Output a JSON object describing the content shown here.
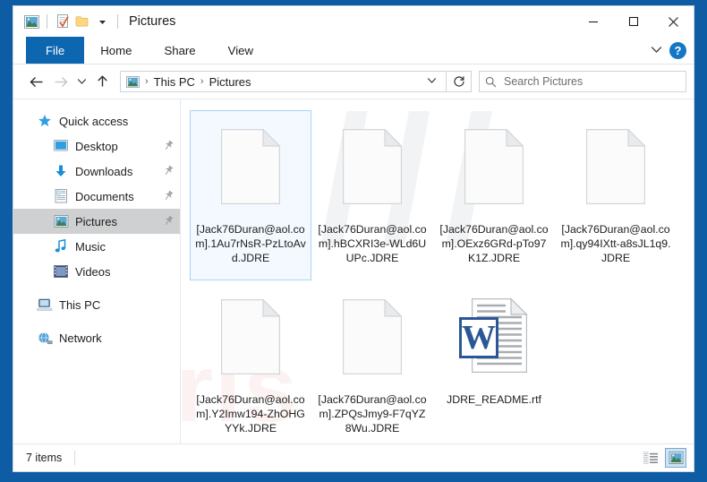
{
  "window": {
    "title": "Pictures",
    "quick_access_icons": [
      "pictures-folder-icon",
      "properties-icon",
      "new-folder-icon",
      "customize-qat-chevron"
    ],
    "controls": {
      "minimize": "–",
      "maximize": "☐",
      "close": "✕"
    }
  },
  "ribbon": {
    "tabs": [
      {
        "label": "File",
        "active": true
      },
      {
        "label": "Home",
        "active": false
      },
      {
        "label": "Share",
        "active": false
      },
      {
        "label": "View",
        "active": false
      }
    ],
    "expand_label": "∨",
    "help_label": "?"
  },
  "address": {
    "back": "←",
    "forward": "→",
    "recent": "∨",
    "up": "↑",
    "breadcrumbs": [
      "This PC",
      "Pictures"
    ],
    "separator": "›",
    "dropdown": "∨",
    "refresh": "↻"
  },
  "search": {
    "placeholder": "Search Pictures",
    "icon": "search-icon"
  },
  "sidebar": {
    "items": [
      {
        "label": "Quick access",
        "icon": "star-icon",
        "level": 0,
        "pinned": false,
        "selected": false
      },
      {
        "label": "Desktop",
        "icon": "desktop-icon",
        "level": 1,
        "pinned": true,
        "selected": false
      },
      {
        "label": "Downloads",
        "icon": "downloads-icon",
        "level": 1,
        "pinned": true,
        "selected": false
      },
      {
        "label": "Documents",
        "icon": "documents-icon",
        "level": 1,
        "pinned": true,
        "selected": false
      },
      {
        "label": "Pictures",
        "icon": "pictures-icon",
        "level": 1,
        "pinned": true,
        "selected": true
      },
      {
        "label": "Music",
        "icon": "music-icon",
        "level": 1,
        "pinned": false,
        "selected": false
      },
      {
        "label": "Videos",
        "icon": "videos-icon",
        "level": 1,
        "pinned": false,
        "selected": false
      },
      {
        "label": "This PC",
        "icon": "this-pc-icon",
        "level": 0,
        "pinned": false,
        "selected": false
      },
      {
        "label": "Network",
        "icon": "network-icon",
        "level": 0,
        "pinned": false,
        "selected": false
      }
    ]
  },
  "files": [
    {
      "name": "[Jack76Duran@aol.com].1Au7rNsR-PzLtoAvd.JDRE",
      "type": "blank",
      "selected": true
    },
    {
      "name": "[Jack76Duran@aol.com].hBCXRI3e-WLd6UUPc.JDRE",
      "type": "blank",
      "selected": false
    },
    {
      "name": "[Jack76Duran@aol.com].OExz6GRd-pTo97K1Z.JDRE",
      "type": "blank",
      "selected": false
    },
    {
      "name": "[Jack76Duran@aol.com].qy94IXtt-a8sJL1q9.JDRE",
      "type": "blank",
      "selected": false
    },
    {
      "name": "[Jack76Duran@aol.com].Y2Imw194-ZhOHGYYk.JDRE",
      "type": "blank",
      "selected": false
    },
    {
      "name": "[Jack76Duran@aol.com].ZPQsJmy9-F7qYZ8Wu.JDRE",
      "type": "blank",
      "selected": false
    },
    {
      "name": "JDRE_README.rtf",
      "type": "rtf",
      "selected": false
    }
  ],
  "statusbar": {
    "item_count": "7 items",
    "views": [
      {
        "name": "details-view",
        "active": false
      },
      {
        "name": "large-icons-view",
        "active": true
      }
    ]
  },
  "watermark": {
    "slash": "///",
    "text": "ris"
  },
  "colors": {
    "desktop_blue": "#0d5ca4",
    "file_tab_blue": "#0d66b0",
    "selection_blue": "#a8d4f5",
    "sidebar_selected": "#cfd0d1",
    "word_blue": "#2b5797"
  }
}
